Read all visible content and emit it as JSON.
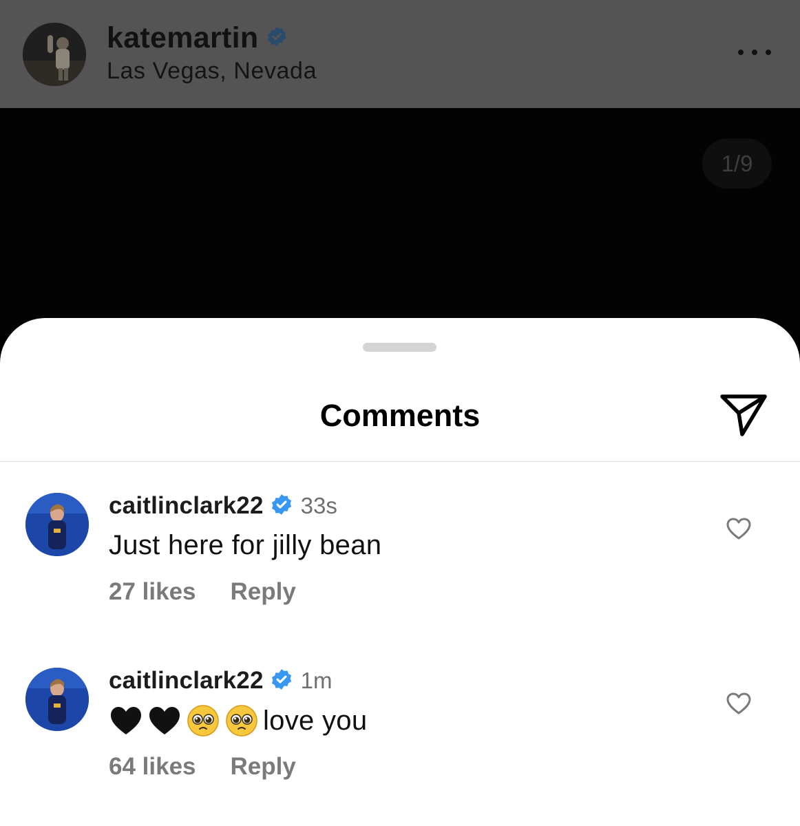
{
  "post": {
    "username": "katemartin",
    "location": "Las Vegas, Nevada",
    "verified": true,
    "more_icon": "ellipsis-horizontal-icon",
    "page_counter": "1/9"
  },
  "comments_sheet": {
    "title": "Comments",
    "share_icon": "paper-plane-icon",
    "comments": [
      {
        "username": "caitlinclark22",
        "verified": true,
        "time": "33s",
        "text": "Just here for jilly bean",
        "likes": "27 likes",
        "reply": "Reply"
      },
      {
        "username": "caitlinclark22",
        "verified": true,
        "time": "1m",
        "emojis": [
          "black-heart",
          "black-heart",
          "pleading-face",
          "pleading-face"
        ],
        "text": "love you",
        "likes": "64 likes",
        "reply": "Reply"
      }
    ]
  },
  "colors": {
    "verified_blue": "#3897f0",
    "overlay_dim": "#545454",
    "secondary_text": "#7a7a7a"
  }
}
